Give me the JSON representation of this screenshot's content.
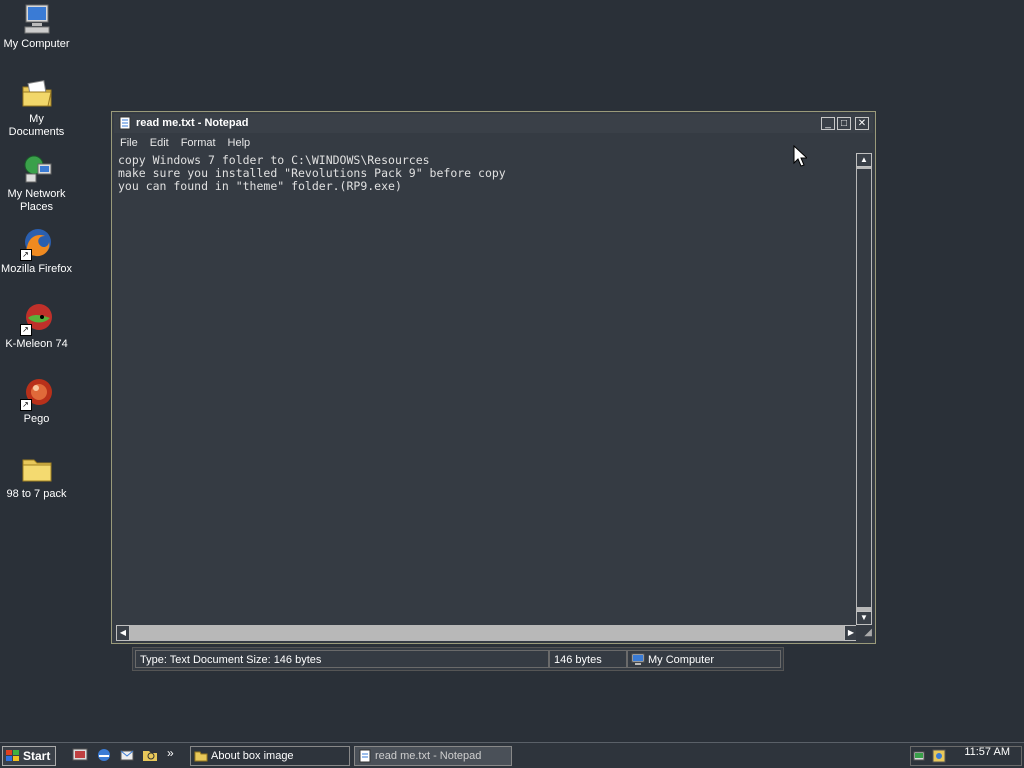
{
  "desktop": {
    "icons": [
      {
        "label": "My Computer",
        "icon": "computer-icon"
      },
      {
        "label": "My Documents",
        "icon": "documents-folder-icon"
      },
      {
        "label": "My Network\nPlaces",
        "icon": "network-icon"
      },
      {
        "label": "Mozilla Firefox",
        "icon": "firefox-icon"
      },
      {
        "label": "K-Meleon 74",
        "icon": "kmeleon-icon"
      },
      {
        "label": "Pego",
        "icon": "pego-icon"
      },
      {
        "label": "98 to 7 pack",
        "icon": "folder-icon"
      }
    ]
  },
  "notepad": {
    "title": "read me.txt - Notepad",
    "menu": [
      "File",
      "Edit",
      "Format",
      "Help"
    ],
    "content": "copy Windows 7 folder to C:\\WINDOWS\\Resources\nmake sure you installed \"Revolutions Pack 9\" before copy\nyou can found in \"theme\" folder.(RP9.exe)",
    "controls": {
      "minimize": "_",
      "maximize": "□",
      "close": "✕"
    }
  },
  "statusbar": {
    "type_info": "Type: Text Document Size: 146 bytes",
    "size": "146 bytes",
    "location": "My Computer"
  },
  "taskbar": {
    "start_label": "Start",
    "chevron": "»",
    "buttons": [
      {
        "label": "About box image",
        "icon": "folder-icon"
      },
      {
        "label": "read me.txt - Notepad",
        "icon": "notepad-icon"
      }
    ],
    "clock": "11:57 AM"
  },
  "colors": {
    "desktop": "#2a3038",
    "window": "#353b43",
    "accent": "#9a9a7a"
  }
}
